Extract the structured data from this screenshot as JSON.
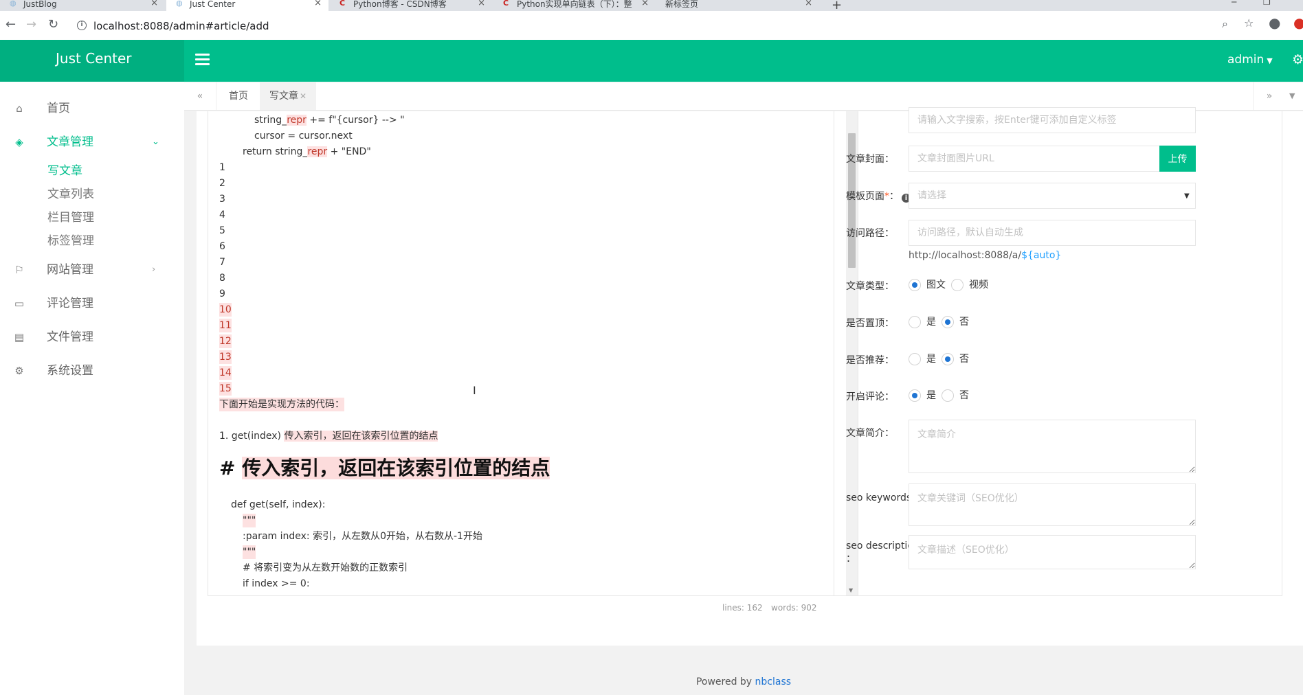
{
  "browser": {
    "tabs": [
      {
        "title": "JustBlog",
        "icon": "globe-icon"
      },
      {
        "title": "Just Center",
        "icon": "globe-icon"
      },
      {
        "title": "Python博客 - CSDN博客",
        "icon": "csdn-icon"
      },
      {
        "title": "Python实现单向链表（下）：整",
        "icon": "csdn-icon"
      },
      {
        "title": "新标签页",
        "icon": ""
      }
    ],
    "url": "localhost:8088/admin#article/add"
  },
  "header": {
    "logo": "Just Center",
    "user": "admin"
  },
  "sidebar": {
    "items": [
      {
        "label": "首页",
        "icon": "home-icon"
      },
      {
        "label": "文章管理",
        "icon": "layers-icon"
      },
      {
        "label": "网站管理",
        "icon": "flag-icon"
      },
      {
        "label": "评论管理",
        "icon": "comment-icon"
      },
      {
        "label": "文件管理",
        "icon": "file-icon"
      },
      {
        "label": "系统设置",
        "icon": "settings-icon"
      }
    ],
    "subitems": [
      {
        "label": "写文章"
      },
      {
        "label": "文章列表"
      },
      {
        "label": "栏目管理"
      },
      {
        "label": "标签管理"
      }
    ]
  },
  "page_tabs": [
    {
      "label": "首页"
    },
    {
      "label": "写文章"
    }
  ],
  "editor": {
    "lines": [
      "string_",
      "repr",
      " += f\"{cursor} --> \"",
      "cursor = cursor.next",
      "return string_",
      "repr",
      " + \"END\""
    ],
    "numbers": [
      "1",
      "2",
      "3",
      "4",
      "5",
      "6",
      "7",
      "8",
      "9",
      "10",
      "11",
      "12",
      "13",
      "14",
      "15"
    ],
    "intro": "下面开始是实现方法的代码：",
    "item1_prefix": "1. get(index) ",
    "item1_text": "传入索引，返回在该索引位置的结点",
    "h1_hash": "# ",
    "h1_text": "传入索引，返回在该索引位置的结点",
    "code": [
      "def get(self, index):",
      "\"\"\"",
      ":param index: 索引，从左数从0开始，从右数从-1开始",
      "\"\"\"",
      "# 将索引变为从左数开始数的正数索引",
      "if index >= 0:"
    ],
    "status_lines": "lines: 162",
    "status_words": "words: 902"
  },
  "form": {
    "tags_placeholder": "请输入文字搜索，按Enter键可添加自定义标签",
    "cover_label": "文章封面：",
    "cover_placeholder": "文章封面图片URL",
    "upload_label": "上传",
    "template_label": "模板页面",
    "template_required": "*",
    "template_colon": "：",
    "template_placeholder": "请选择",
    "path_label": "访问路径：",
    "path_placeholder": "访问路径，默认自动生成",
    "path_hint": "http://localhost:8088/a/",
    "path_hint_auto": "${auto}",
    "type_label": "文章类型：",
    "type_opt1": "图文",
    "type_opt2": "视频",
    "top_label": "是否置顶：",
    "recommend_label": "是否推荐：",
    "comment_label": "开启评论：",
    "yes": "是",
    "no": "否",
    "summary_label": "文章简介：",
    "summary_placeholder": "文章简介",
    "seo_kw_label": "seo keywords：",
    "seo_kw_placeholder": "文章关键词（SEO优化）",
    "seo_desc_label": "seo description",
    "seo_desc_colon": "：",
    "seo_desc_placeholder": "文章描述（SEO优化）"
  },
  "footer": {
    "text": "Powered by ",
    "link": "nbclass"
  },
  "colors": {
    "brand": "#00be8c",
    "radio": "#1e74d3",
    "highlight": "#fde1e1"
  }
}
